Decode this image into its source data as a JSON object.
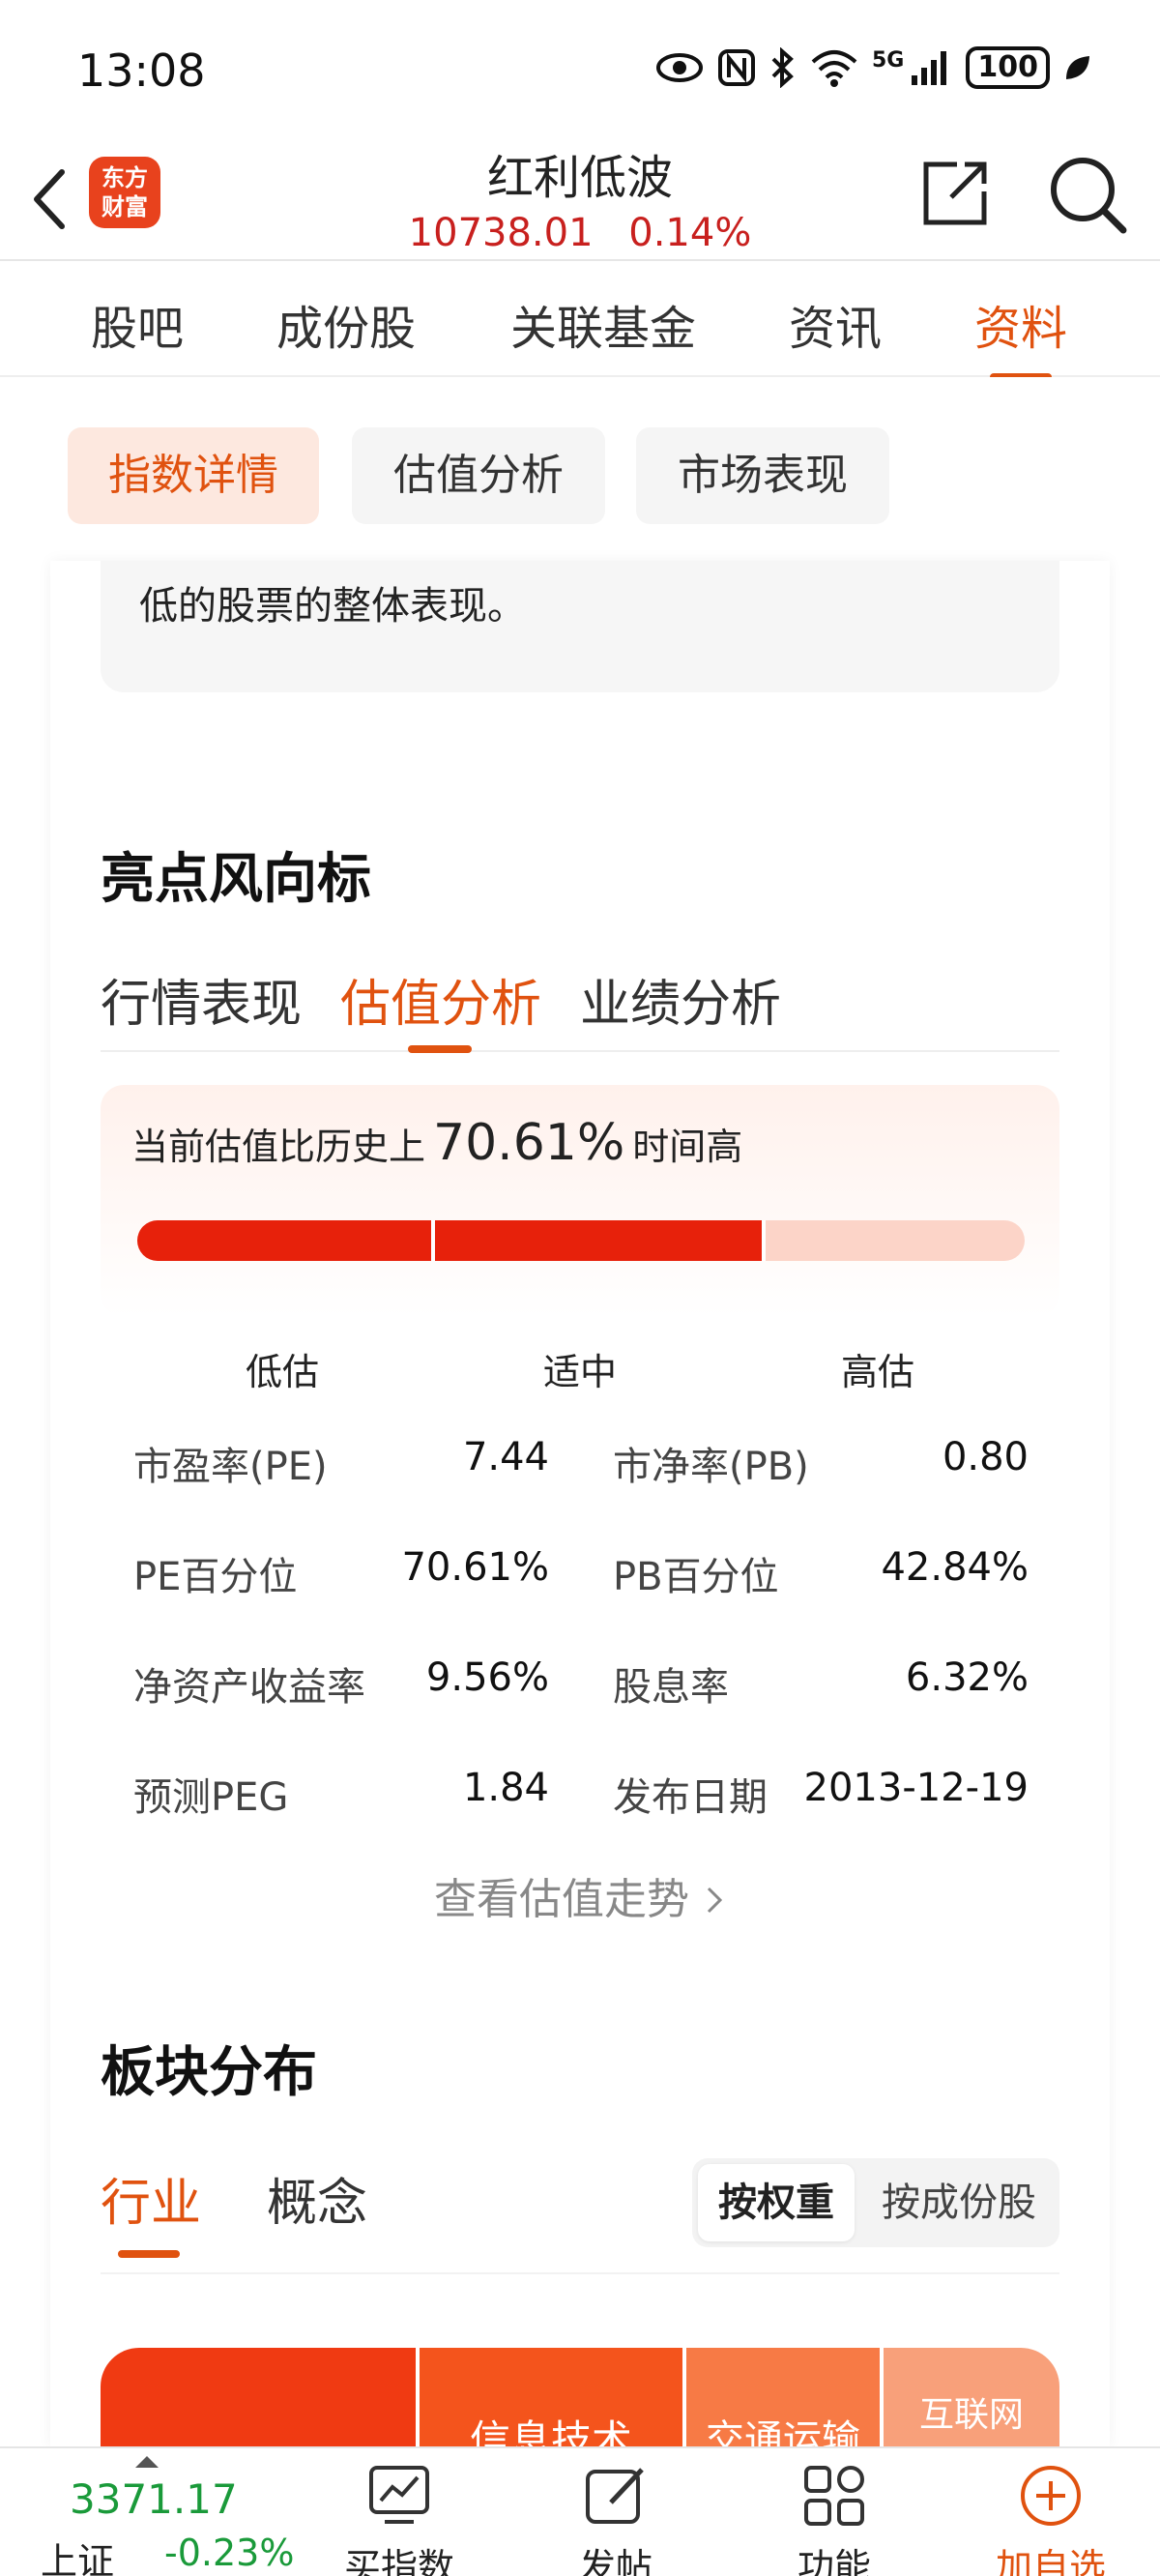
{
  "status_bar": {
    "time": "13:08",
    "network": "5G",
    "battery": "100"
  },
  "header": {
    "logo_line1": "东方",
    "logo_line2": "财富",
    "title": "红利低波",
    "price": "10738.01",
    "change": "0.14%"
  },
  "main_tabs": [
    {
      "label": "股吧"
    },
    {
      "label": "成份股"
    },
    {
      "label": "关联基金"
    },
    {
      "label": "资讯"
    },
    {
      "label": "资料"
    }
  ],
  "sub_tabs": [
    {
      "label": "指数详情"
    },
    {
      "label": "估值分析"
    },
    {
      "label": "市场表现"
    }
  ],
  "description": {
    "text": "率股，采用股息率加权，以反映分红水平高且波动率低的股票的整体表现。"
  },
  "highlights": {
    "title": "亮点风向标",
    "tabs": [
      {
        "label": "行情表现"
      },
      {
        "label": "估值分析"
      },
      {
        "label": "业绩分析"
      }
    ],
    "valuation": {
      "prefix": "当前估值比历史上",
      "percent": "70.61%",
      "suffix": "时间高",
      "level_fraction": 0.7061,
      "labels": [
        "低估",
        "适中",
        "高估"
      ]
    },
    "metrics": [
      {
        "label": "市盈率(PE)",
        "value": "7.44"
      },
      {
        "label": "市净率(PB)",
        "value": "0.80"
      },
      {
        "label": "PE百分位",
        "value": "70.61%"
      },
      {
        "label": "PB百分位",
        "value": "42.84%"
      },
      {
        "label": "净资产收益率",
        "value": "9.56%"
      },
      {
        "label": "股息率",
        "value": "6.32%"
      },
      {
        "label": "预测PEG",
        "value": "1.84"
      },
      {
        "label": "发布日期",
        "value": "2013-12-19"
      }
    ],
    "trend_link": "查看估值走势"
  },
  "sector": {
    "title": "板块分布",
    "tabs": [
      {
        "label": "行业"
      },
      {
        "label": "概念"
      }
    ],
    "toggle": [
      {
        "label": "按权重"
      },
      {
        "label": "按成份股"
      }
    ],
    "tree_cells": [
      {
        "label": "",
        "color": "#f03a12"
      },
      {
        "label": "信息技术",
        "color": "#f4541c"
      },
      {
        "label": "交通运输",
        "color": "#f77a45"
      },
      {
        "label": "互联网",
        "color": "#f8a07a"
      }
    ]
  },
  "bottom_bar": {
    "index_value": "3371.17",
    "index_name": "上证",
    "index_change": "-0.23%",
    "nav": [
      {
        "label": "买指数"
      },
      {
        "label": "发帖"
      },
      {
        "label": "功能"
      },
      {
        "label": "加自选"
      }
    ]
  },
  "colors": {
    "accent": "#e0520f",
    "price_up": "#c8201e",
    "price_down": "#1a9a3a",
    "bar_fill": "#e7210b",
    "bar_track": "#fcd4c8"
  }
}
